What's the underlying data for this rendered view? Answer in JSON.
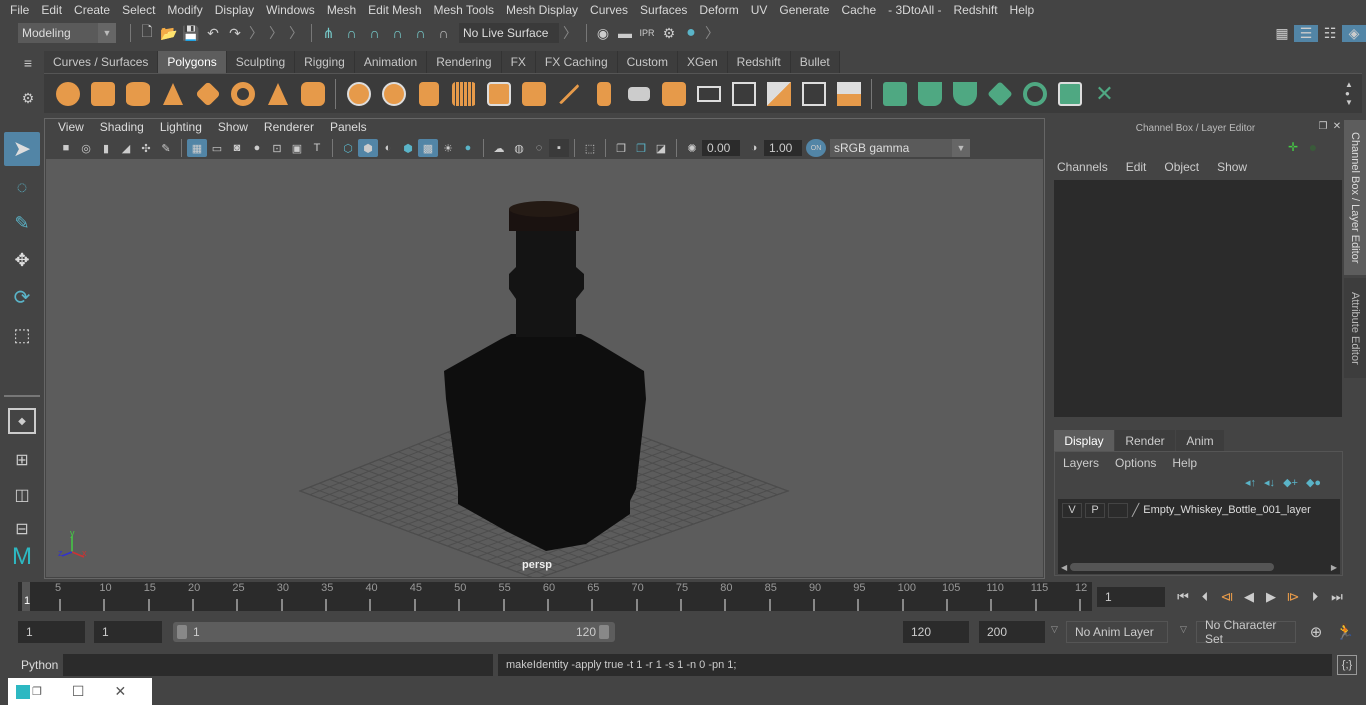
{
  "menubar": [
    "File",
    "Edit",
    "Create",
    "Select",
    "Modify",
    "Display",
    "Windows",
    "Mesh",
    "Edit Mesh",
    "Mesh Tools",
    "Mesh Display",
    "Curves",
    "Surfaces",
    "Deform",
    "UV",
    "Generate",
    "Cache",
    "- 3DtoAll -",
    "Redshift",
    "Help"
  ],
  "statusline": {
    "mode": "Modeling",
    "live_surface": "No Live Surface",
    "icons": [
      "new-scene-icon",
      "open-scene-icon",
      "save-scene-icon",
      "undo-icon",
      "redo-icon",
      "snap-grid-icon",
      "snap-curve-icon",
      "snap-point-icon",
      "snap-view-plane-icon",
      "snap-live-icon",
      "snap-projected-icon",
      "render-view-icon",
      "render-current-frame-icon",
      "ipr-render-icon",
      "render-settings-icon",
      "hypershade-icon"
    ],
    "right_icons": [
      "modeling-toolkit-icon",
      "attribute-editor-icon",
      "tool-settings-icon",
      "channel-box-icon"
    ]
  },
  "shelf": {
    "tabs": [
      "Curves / Surfaces",
      "Polygons",
      "Sculpting",
      "Rigging",
      "Animation",
      "Rendering",
      "FX",
      "FX Caching",
      "Custom",
      "XGen",
      "Redshift",
      "Bullet"
    ],
    "active_tab": "Polygons",
    "orange_icons": [
      "poly-sphere-icon",
      "poly-cube-icon",
      "poly-cylinder-icon",
      "poly-cone-icon",
      "poly-plane-icon",
      "poly-torus-icon",
      "poly-pyramid-icon",
      "poly-pipe-icon"
    ],
    "tool_icons": [
      "combine-icon",
      "separate-icon",
      "mirror-icon",
      "smooth-icon",
      "extract-icon",
      "booleans-icon",
      "multi-cut-icon",
      "extrude-icon",
      "bridge-icon",
      "bevel-icon",
      "insert-edge-loop-icon",
      "append-polygon-icon",
      "fill-hole-icon",
      "target-weld-icon",
      "reduce-icon",
      "merge-icon"
    ],
    "green_icons": [
      "planar-uv-icon",
      "cylindrical-uv-icon",
      "spherical-uv-icon",
      "automatic-uv-icon",
      "contour-stretch-uv-icon",
      "uv-editor-icon",
      "unfold-uv-icon"
    ]
  },
  "viewport": {
    "menu": [
      "View",
      "Shading",
      "Lighting",
      "Show",
      "Renderer",
      "Panels"
    ],
    "exposure": "0.00",
    "gamma": "1.00",
    "colorspace": "sRGB gamma",
    "color_mgmt": "ON",
    "camera_label": "persp",
    "axis": {
      "x": "x",
      "y": "y",
      "z": "z"
    }
  },
  "channelbox": {
    "title": "Channel Box / Layer Editor",
    "menu": [
      "Channels",
      "Edit",
      "Object",
      "Show"
    ],
    "layer_tabs": [
      "Display",
      "Render",
      "Anim"
    ],
    "active_layer_tab": "Display",
    "layer_menu": [
      "Layers",
      "Options",
      "Help"
    ],
    "layers": [
      {
        "v": "V",
        "p": "P",
        "name": "Empty_Whiskey_Bottle_001_layer"
      }
    ]
  },
  "side_tabs": [
    "Channel Box / Layer Editor",
    "Attribute Editor"
  ],
  "timeline": {
    "ticks": [
      "5",
      "10",
      "15",
      "20",
      "25",
      "30",
      "35",
      "40",
      "45",
      "50",
      "55",
      "60",
      "65",
      "70",
      "75",
      "80",
      "85",
      "90",
      "95",
      "100",
      "105",
      "110",
      "115",
      "12"
    ],
    "current_marker": "1",
    "current_frame": "1"
  },
  "range": {
    "start": "1",
    "playback_start": "1",
    "slider_start": "1",
    "slider_end": "120",
    "playback_end": "120",
    "end": "200",
    "anim_layer": "No Anim Layer",
    "char_set": "No Character Set"
  },
  "cmdline": {
    "lang": "Python",
    "input": "",
    "result": "makeIdentity -apply true -t 1 -r 1 -s 1 -n 0 -pn 1;"
  },
  "colors": {
    "accent": "#5285a6",
    "shelf_orange": "#e69a4a",
    "shelf_green": "#4fa882",
    "viewport_bg": "#5c5c5c"
  }
}
